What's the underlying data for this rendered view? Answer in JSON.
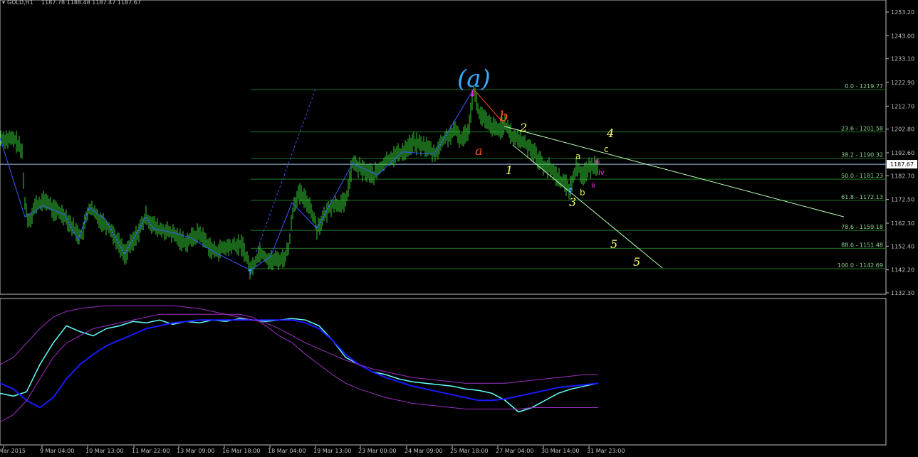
{
  "header": {
    "symbol_text": "GOLD,H1",
    "ohlc_text": "1187.78 1188.48 1187.47 1187.67"
  },
  "colors": {
    "background": "#000000",
    "candles": "#33cc33",
    "axis": "#c0c0c0",
    "fib_line": "#1f7a1f",
    "fib_label": "#8fd18f",
    "current_price_line": "#9fc6e8",
    "trendline": "#b8ffb8",
    "wave_path": "#3a5bff",
    "osc_blue": "#1a1aff",
    "osc_cyan": "#66ffff",
    "osc_magenta": "#9a2fbf",
    "label_yellow": "#ffff66",
    "label_red": "#ff4d1a",
    "label_cyan_blue": "#33aaff",
    "label_magenta": "#ff33ff",
    "label_yellowgreen": "#d9f266"
  },
  "chart_data": [
    {
      "type": "candlestick",
      "title": "GOLD,H1",
      "y_ticks": [
        "1253.20",
        "1243.00",
        "1233.10",
        "1222.90",
        "1212.70",
        "1202.80",
        "1192.60",
        "1182.70",
        "1172.50",
        "1162.30",
        "1152.40",
        "1142.20",
        "1132.30"
      ],
      "ylim": [
        1132.3,
        1256.0
      ],
      "current_price": "1187.67",
      "x_ticks": [
        "Mar 2015",
        "9 Mar 04:00",
        "10 Mar 13:00",
        "11 Mar 22:00",
        "13 Mar 09:00",
        "16 Mar 18:00",
        "18 Mar 04:00",
        "19 Mar 13:00",
        "23 Mar 00:00",
        "24 Mar 09:00",
        "25 Mar 18:00",
        "27 Mar 04:00",
        "30 Mar 14:00",
        "31 Mar 23:00"
      ],
      "price_path": [
        [
          0,
          1199
        ],
        [
          22,
          1198
        ],
        [
          32,
          1192
        ],
        [
          34,
          1172
        ],
        [
          40,
          1163
        ],
        [
          50,
          1170
        ],
        [
          65,
          1172
        ],
        [
          75,
          1168
        ],
        [
          90,
          1166
        ],
        [
          108,
          1158
        ],
        [
          115,
          1157
        ],
        [
          125,
          1169
        ],
        [
          140,
          1164
        ],
        [
          155,
          1160
        ],
        [
          175,
          1149
        ],
        [
          190,
          1156
        ],
        [
          205,
          1165
        ],
        [
          220,
          1160
        ],
        [
          240,
          1158
        ],
        [
          260,
          1154
        ],
        [
          280,
          1158
        ],
        [
          300,
          1150
        ],
        [
          320,
          1152
        ],
        [
          340,
          1153
        ],
        [
          352,
          1142
        ],
        [
          365,
          1150
        ],
        [
          380,
          1146
        ],
        [
          398,
          1147
        ],
        [
          405,
          1151
        ],
        [
          412,
          1170
        ],
        [
          420,
          1175
        ],
        [
          435,
          1170
        ],
        [
          445,
          1160
        ],
        [
          465,
          1170
        ],
        [
          485,
          1171
        ],
        [
          495,
          1188
        ],
        [
          510,
          1185
        ],
        [
          525,
          1183
        ],
        [
          545,
          1190
        ],
        [
          565,
          1193
        ],
        [
          580,
          1197
        ],
        [
          600,
          1195
        ],
        [
          610,
          1192
        ],
        [
          625,
          1199
        ],
        [
          640,
          1202
        ],
        [
          648,
          1198
        ],
        [
          658,
          1203
        ],
        [
          665,
          1220
        ],
        [
          672,
          1210
        ],
        [
          685,
          1205
        ],
        [
          700,
          1202
        ],
        [
          708,
          1205
        ],
        [
          718,
          1200
        ],
        [
          730,
          1198
        ],
        [
          745,
          1195
        ],
        [
          760,
          1188
        ],
        [
          775,
          1185
        ],
        [
          790,
          1180
        ],
        [
          800,
          1177
        ],
        [
          810,
          1187
        ],
        [
          818,
          1183
        ],
        [
          828,
          1186
        ],
        [
          840,
          1188
        ]
      ],
      "fibonacci": {
        "levels": [
          {
            "ratio": "0.0",
            "price": "1219.77"
          },
          {
            "ratio": "23.6",
            "price": "1201.58"
          },
          {
            "ratio": "38.2",
            "price": "1190.32"
          },
          {
            "ratio": "50.0",
            "price": "1181.23"
          },
          {
            "ratio": "61.8",
            "price": "1172.13"
          },
          {
            "ratio": "78.6",
            "price": "1159.18"
          },
          {
            "ratio": "88.6",
            "price": "1151.48"
          },
          {
            "ratio": "100.0",
            "price": "1142.69"
          }
        ]
      },
      "wave_labels": [
        {
          "text": "(a)",
          "color_key": "label_cyan_blue"
        },
        {
          "text": "b",
          "color_key": "label_red"
        },
        {
          "text": "a",
          "color_key": "label_red"
        },
        {
          "text": "2",
          "color_key": "label_yellow"
        },
        {
          "text": "1",
          "color_key": "label_yellow"
        },
        {
          "text": "4",
          "color_key": "label_yellow"
        },
        {
          "text": "3",
          "color_key": "label_yellow"
        },
        {
          "text": "5",
          "color_key": "label_yellow"
        },
        {
          "text": "5",
          "color_key": "label_yellow"
        },
        {
          "text": "a",
          "color_key": "label_yellowgreen"
        },
        {
          "text": "b",
          "color_key": "label_yellowgreen"
        },
        {
          "text": "c",
          "color_key": "label_yellowgreen"
        },
        {
          "text": "ii",
          "color_key": "label_magenta"
        },
        {
          "text": "iii",
          "color_key": "label_magenta"
        },
        {
          "text": "iv",
          "color_key": "label_magenta"
        }
      ]
    },
    {
      "type": "line",
      "title": "",
      "series": [
        {
          "values": [
            0.35,
            0.33,
            0.36,
            0.55,
            0.7,
            0.82,
            0.78,
            0.75,
            0.8,
            0.82,
            0.85,
            0.84,
            0.86,
            0.83,
            0.85,
            0.84,
            0.86,
            0.85,
            0.87,
            0.86,
            0.85,
            0.86,
            0.87,
            0.86,
            0.82,
            0.72,
            0.6,
            0.55,
            0.5,
            0.48,
            0.45,
            0.43,
            0.42,
            0.41,
            0.4,
            0.38,
            0.37,
            0.35,
            0.3,
            0.22,
            0.25,
            0.3,
            0.35,
            0.38,
            0.4,
            0.42
          ]
        },
        {
          "values": [
            0.42,
            0.38,
            0.3,
            0.25,
            0.32,
            0.45,
            0.55,
            0.62,
            0.68,
            0.72,
            0.76,
            0.8,
            0.82,
            0.84,
            0.85,
            0.86,
            0.86,
            0.86,
            0.86,
            0.86,
            0.86,
            0.86,
            0.86,
            0.84,
            0.8,
            0.72,
            0.62,
            0.55,
            0.5,
            0.46,
            0.43,
            0.4,
            0.38,
            0.36,
            0.34,
            0.32,
            0.3,
            0.3,
            0.31,
            0.33,
            0.35,
            0.37,
            0.39,
            0.4,
            0.41,
            0.42
          ]
        },
        {
          "values": [
            0.15,
            0.2,
            0.3,
            0.45,
            0.6,
            0.7,
            0.75,
            0.8,
            0.82,
            0.84,
            0.86,
            0.88,
            0.9,
            0.9,
            0.9,
            0.9,
            0.9,
            0.9,
            0.9,
            0.88,
            0.82,
            0.75,
            0.7,
            0.62,
            0.55,
            0.48,
            0.42,
            0.38,
            0.35,
            0.32,
            0.3,
            0.28,
            0.27,
            0.26,
            0.25,
            0.24,
            0.24,
            0.24,
            0.24,
            0.24,
            0.25,
            0.25,
            0.25,
            0.25,
            0.25,
            0.25
          ]
        },
        {
          "values": [
            0.55,
            0.6,
            0.7,
            0.8,
            0.88,
            0.92,
            0.94,
            0.95,
            0.96,
            0.96,
            0.96,
            0.96,
            0.96,
            0.96,
            0.95,
            0.94,
            0.92,
            0.9,
            0.88,
            0.86,
            0.84,
            0.8,
            0.75,
            0.7,
            0.66,
            0.62,
            0.58,
            0.55,
            0.52,
            0.5,
            0.48,
            0.46,
            0.45,
            0.44,
            0.43,
            0.42,
            0.42,
            0.42,
            0.42,
            0.43,
            0.44,
            0.45,
            0.46,
            0.47,
            0.48,
            0.48
          ]
        }
      ]
    }
  ]
}
